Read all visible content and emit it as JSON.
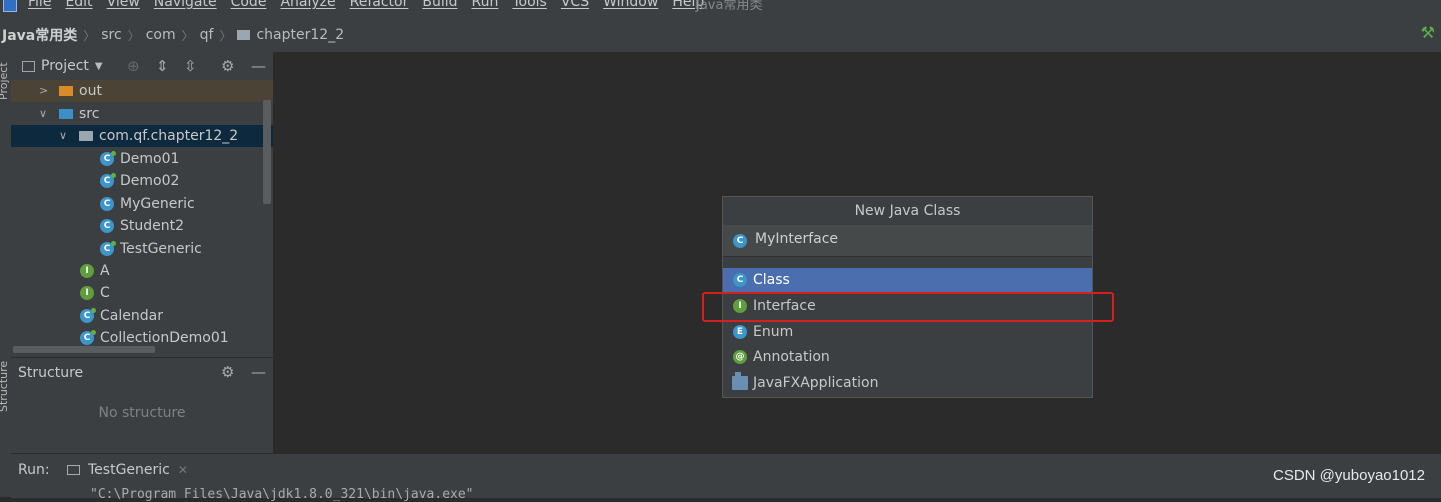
{
  "menu": {
    "items": [
      "File",
      "Edit",
      "View",
      "Navigate",
      "Code",
      "Analyze",
      "Refactor",
      "Build",
      "Run",
      "Tools",
      "VCS",
      "Window",
      "Help"
    ],
    "window_title": "Java常用类"
  },
  "breadcrumb": {
    "project": "Java常用类",
    "items": [
      "src",
      "com",
      "qf"
    ],
    "current": "chapter12_2"
  },
  "project_panel": {
    "title": "Project",
    "tree": [
      {
        "label": "out"
      },
      {
        "label": "src"
      },
      {
        "label": "com.qf.chapter12_2"
      },
      {
        "label": "Demo01"
      },
      {
        "label": "Demo02"
      },
      {
        "label": "MyGeneric"
      },
      {
        "label": "Student2"
      },
      {
        "label": "TestGeneric"
      },
      {
        "label": "A"
      },
      {
        "label": "C"
      },
      {
        "label": "Calendar"
      },
      {
        "label": "CollectionDemo01"
      }
    ]
  },
  "structure_panel": {
    "title": "Structure",
    "empty_text": "No structure"
  },
  "left_stripe": {
    "project_label": "Project",
    "structure_label": "Structure"
  },
  "dialog": {
    "title": "New Java Class",
    "name_value": "MyInterface",
    "kinds": [
      {
        "label": "Class",
        "icon": "class-icon"
      },
      {
        "label": "Interface",
        "icon": "interface-icon"
      },
      {
        "label": "Enum",
        "icon": "enum-icon"
      },
      {
        "label": "Annotation",
        "icon": "annotation-icon"
      },
      {
        "label": "JavaFXApplication",
        "icon": "javafx-icon"
      }
    ],
    "selected_kind": "Class",
    "highlighted_kind": "Interface"
  },
  "run_bar": {
    "label": "Run:",
    "tab": "TestGeneric",
    "command": "\"C:\\Program Files\\Java\\jdk1.8.0_321\\bin\\java.exe\""
  },
  "watermark": "CSDN @yuboyao1012",
  "colors": {
    "selection": "#4b6eaf",
    "highlight_border": "#d62020",
    "background": "#2b2b2b",
    "panel": "#3c3f41"
  }
}
